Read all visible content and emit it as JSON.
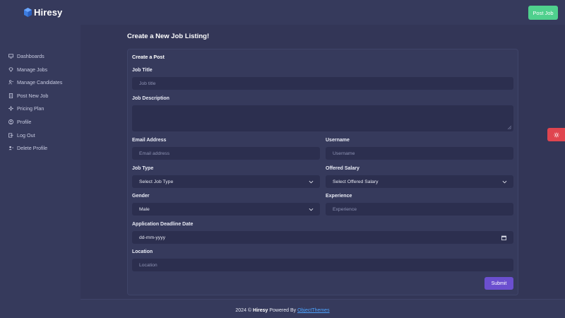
{
  "header": {
    "brand": "Hiresy",
    "post_job_label": "Post Job"
  },
  "sidebar": {
    "items": [
      {
        "label": "Dashboards",
        "icon": "monitor-icon"
      },
      {
        "label": "Manage Jobs",
        "icon": "diamond-icon"
      },
      {
        "label": "Manage Candidates",
        "icon": "users-icon"
      },
      {
        "label": "Post New Job",
        "icon": "document-icon"
      },
      {
        "label": "Pricing Plan",
        "icon": "sparkle-icon"
      },
      {
        "label": "Profile",
        "icon": "user-circle-icon"
      },
      {
        "label": "Log Out",
        "icon": "logout-icon"
      },
      {
        "label": "Delete Profile",
        "icon": "user-remove-icon"
      }
    ]
  },
  "main": {
    "page_title": "Create a New Job Listing!",
    "card_title": "Create a Post",
    "form": {
      "job_title": {
        "label": "Job Title",
        "placeholder": "Job title"
      },
      "job_description": {
        "label": "Job Description"
      },
      "email": {
        "label": "Email Address",
        "placeholder": "Email address"
      },
      "username": {
        "label": "Username",
        "placeholder": "Username"
      },
      "job_type": {
        "label": "Job Type",
        "value": "Select Job Type"
      },
      "salary": {
        "label": "Offered Salary",
        "value": "Select Offered Salary"
      },
      "gender": {
        "label": "Gender",
        "value": "Male"
      },
      "experience": {
        "label": "Experience",
        "placeholder": "Experience"
      },
      "deadline": {
        "label": "Application Deadline Date",
        "value": "dd-mm-yyyy"
      },
      "location": {
        "label": "Location",
        "placeholder": "Location"
      },
      "submit_label": "Submit"
    }
  },
  "footer": {
    "prefix": "2024 © ",
    "brand": "Hiresy",
    "middle": " Powered By ",
    "link": "ObjectThemes"
  },
  "colors": {
    "accent_green": "#4fd08d",
    "accent_purple": "#6b4fcf",
    "theme_toggle": "#e0454f",
    "link": "#4da3ff"
  }
}
